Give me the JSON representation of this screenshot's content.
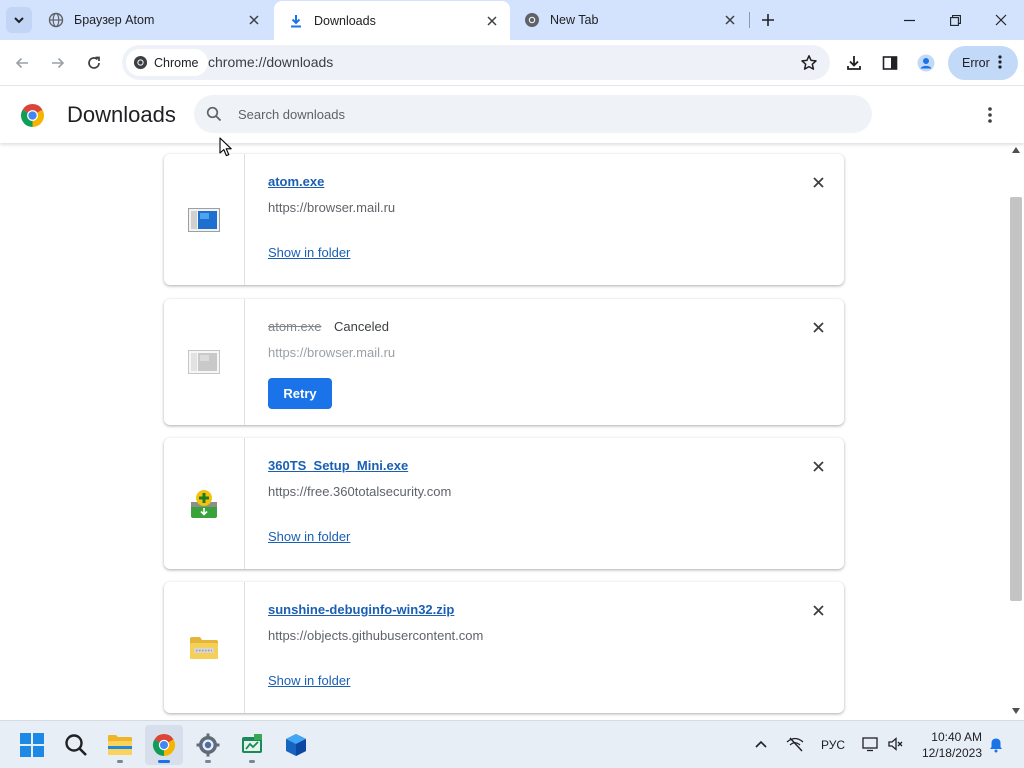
{
  "browser": {
    "tabs": [
      {
        "title": "Браузер Atom",
        "icon": "globe-icon",
        "active": false
      },
      {
        "title": "Downloads",
        "icon": "download-icon",
        "active": true
      },
      {
        "title": "New Tab",
        "icon": "chrome-icon",
        "active": false
      }
    ],
    "chip_label": "Chrome",
    "url": "chrome://downloads",
    "profile_button_label": "Error"
  },
  "downloads_page": {
    "title": "Downloads",
    "search_placeholder": "Search downloads",
    "items": [
      {
        "filename": "atom.exe",
        "source": "https://browser.mail.ru",
        "status": "",
        "action": "Show in folder",
        "icon": "app-window-icon",
        "state": "complete"
      },
      {
        "filename": "atom.exe",
        "source": "https://browser.mail.ru",
        "status": "Canceled",
        "action": "Retry",
        "icon": "app-window-icon",
        "state": "canceled"
      },
      {
        "filename": "360TS_Setup_Mini.exe",
        "source": "https://free.360totalsecurity.com",
        "status": "",
        "action": "Show in folder",
        "icon": "installer-icon",
        "state": "complete"
      },
      {
        "filename": "sunshine-debuginfo-win32.zip",
        "source": "https://objects.githubusercontent.com",
        "status": "",
        "action": "Show in folder",
        "icon": "zip-folder-icon",
        "state": "complete"
      }
    ]
  },
  "taskbar": {
    "language": "РУС",
    "time": "10:40 AM",
    "date": "12/18/2023",
    "apps": [
      "start-icon",
      "search-icon",
      "file-explorer-icon",
      "chrome-icon",
      "settings-icon",
      "app-icon",
      "box-app-icon"
    ]
  },
  "colors": {
    "accent": "#1a73e8",
    "link": "#1a5fb4",
    "tabstrip": "#d3e3fd"
  }
}
